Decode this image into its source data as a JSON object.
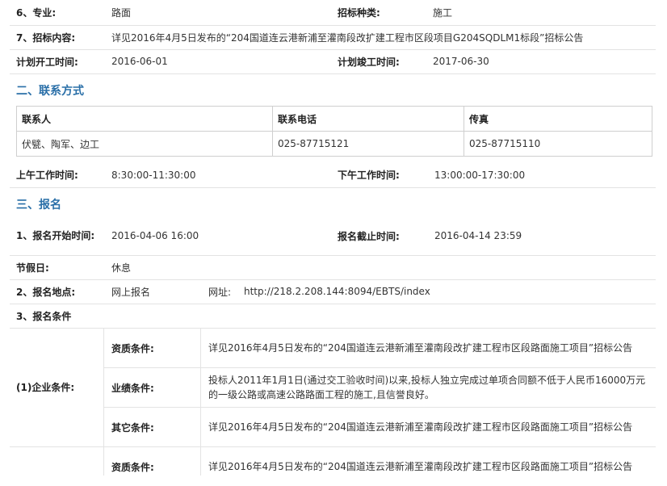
{
  "info": {
    "major_label": "6、专业:",
    "major_value": "路面",
    "bid_type_label": "招标种类:",
    "bid_type_value": "施工",
    "content_label": "7、招标内容:",
    "content_value": "详见2016年4月5日发布的“204国道连云港新浦至灌南段改扩建工程市区段项目G204SQDLM1标段”招标公告",
    "start_label": "计划开工时间:",
    "start_value": "2016-06-01",
    "end_label": "计划竣工时间:",
    "end_value": "2017-06-30"
  },
  "contact": {
    "section_title": "二、联系方式",
    "headers": [
      "联系人",
      "联系电话",
      "传真"
    ],
    "row": [
      "伏甓、陶军、边工",
      "025-87715121",
      "025-87715110"
    ],
    "am_label": "上午工作时间:",
    "am_value": "8:30:00-11:30:00",
    "pm_label": "下午工作时间:",
    "pm_value": "13:00:00-17:30:00"
  },
  "signup": {
    "section_title": "三、报名",
    "begin_label": "1、报名开始时间:",
    "begin_value": "2016-04-06 16:00",
    "deadline_label": "报名截止时间:",
    "deadline_value": "2016-04-14 23:59",
    "holiday_label": "节假日:",
    "holiday_value": "休息",
    "place_label": "2、报名地点:",
    "place_value": "网上报名",
    "url_label": "网址:",
    "url_value": "http://218.2.208.144:8094/EBTS/index",
    "cond_label": "3、报名条件",
    "enterprise_label": "(1)企业条件:",
    "conditions": [
      {
        "label": "资质条件:",
        "value": "详见2016年4月5日发布的“204国道连云港新浦至灌南段改扩建工程市区段路面施工项目”招标公告"
      },
      {
        "label": "业绩条件:",
        "value": "投标人2011年1月1日(通过交工验收时间)以来,投标人独立完成过单项合同额不低于人民币16000万元的一级公路或高速公路路面工程的施工,且信誉良好。"
      },
      {
        "label": "其它条件:",
        "value": "详见2016年4月5日发布的“204国道连云港新浦至灌南段改扩建工程市区段路面施工项目”招标公告"
      },
      {
        "label": "资质条件:",
        "value": "详见2016年4月5日发布的“204国道连云港新浦至灌南段改扩建工程市区段路面施工项目”招标公告"
      }
    ]
  }
}
